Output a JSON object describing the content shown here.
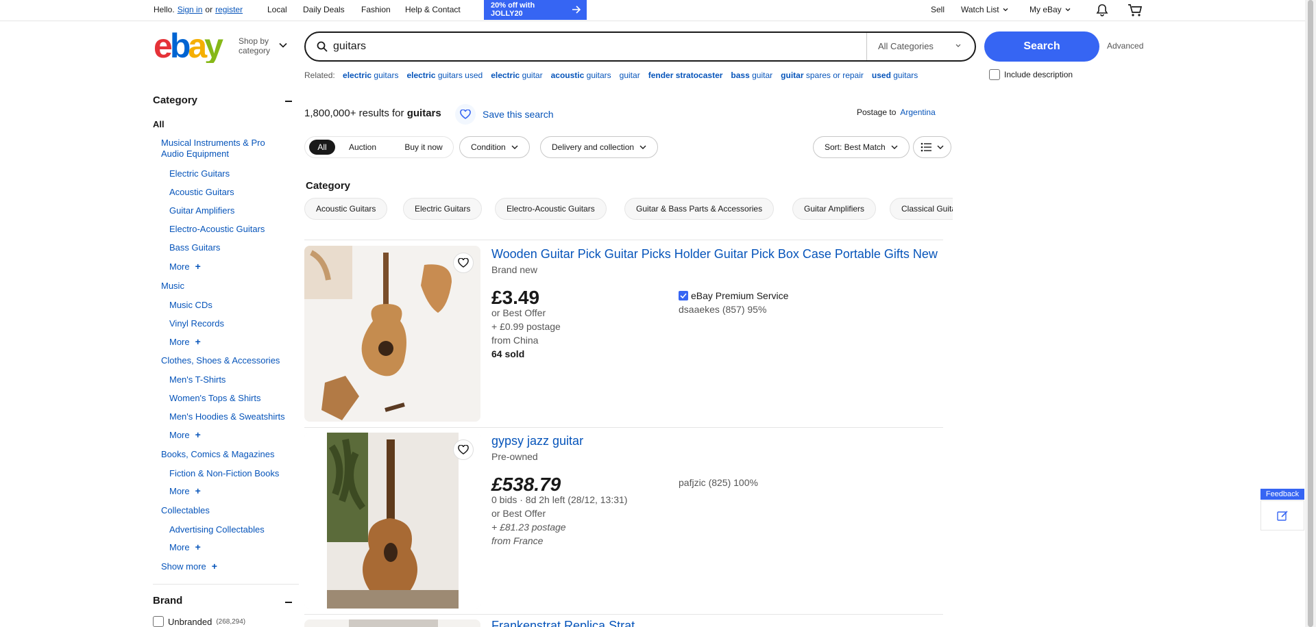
{
  "topbar": {
    "hello": "Hello.",
    "sign_in": "Sign in",
    "or": "or",
    "register": "register",
    "local": "Local",
    "daily_deals": "Daily Deals",
    "fashion": "Fashion",
    "help": "Help & Contact",
    "promo_line1": "20% off with",
    "promo_line2": "JOLLY20",
    "sell": "Sell",
    "watch_list": "Watch List",
    "my_ebay": "My eBay",
    "icons": [
      "bell-icon",
      "cart-icon"
    ]
  },
  "header": {
    "logo_letters": [
      "e",
      "b",
      "a",
      "y"
    ],
    "logo_colors": [
      "#e53238",
      "#0064d2",
      "#f5af02",
      "#86b817"
    ],
    "shop_by_line1": "Shop by",
    "shop_by_line2": "category",
    "search_value": "guitars",
    "category_select": "All Categories",
    "search_button": "Search",
    "advanced": "Advanced"
  },
  "related": {
    "label": "Related:",
    "items": [
      {
        "a": "electric",
        "b": "guitars"
      },
      {
        "a": "electric",
        "b": "guitars used"
      },
      {
        "a": "electric",
        "b": "guitar"
      },
      {
        "a": "acoustic",
        "b": "guitars"
      },
      {
        "a": "",
        "b": "guitar"
      },
      {
        "a": "fender stratocaster",
        "b": ""
      },
      {
        "a": "bass",
        "b": "guitar"
      },
      {
        "a": "guitar",
        "b": "spares or repair"
      },
      {
        "a": "used",
        "b": "guitars"
      }
    ],
    "include_description": "Include description"
  },
  "sidebar": {
    "category_heading": "Category",
    "all": "All",
    "groups": [
      {
        "title": "Musical Instruments & Pro Audio Equipment",
        "items": [
          "Electric Guitars",
          "Acoustic Guitars",
          "Guitar Amplifiers",
          "Electro-Acoustic Guitars",
          "Bass Guitars"
        ],
        "more": "More"
      },
      {
        "title": "Music",
        "items": [
          "Music CDs",
          "Vinyl Records"
        ],
        "more": "More"
      },
      {
        "title": "Clothes, Shoes & Accessories",
        "items": [
          "Men's T-Shirts",
          "Women's Tops & Shirts",
          "Men's Hoodies & Sweatshirts"
        ],
        "more": "More"
      },
      {
        "title": "Books, Comics & Magazines",
        "items": [
          "Fiction & Non-Fiction Books"
        ],
        "more": "More"
      },
      {
        "title": "Collectables",
        "items": [
          "Advertising Collectables"
        ],
        "more": "More"
      }
    ],
    "show_more": "Show more",
    "brand_heading": "Brand",
    "brand_items": [
      {
        "label": "Unbranded",
        "count": "(268,294)"
      }
    ]
  },
  "results": {
    "count": "1,800,000+",
    "results_for": "results for",
    "query": "guitars",
    "save_search": "Save this search",
    "postage_to": "Postage to",
    "country": "Argentina"
  },
  "filters": {
    "tabs": [
      "All",
      "Auction",
      "Buy it now"
    ],
    "active_tab": "All",
    "condition": "Condition",
    "delivery": "Delivery and collection",
    "sort": "Sort: Best Match"
  },
  "categories": {
    "label": "Category",
    "chips": [
      "Acoustic Guitars",
      "Electric Guitars",
      "Electro-Acoustic Guitars",
      "Guitar & Bass Parts & Accessories",
      "Guitar Amplifiers",
      "Classical Guitars"
    ]
  },
  "listings": [
    {
      "title": "Wooden Guitar Pick Guitar Picks Holder Guitar Pick Box Case Portable Gifts New",
      "condition": "Brand new",
      "price": "£3.49",
      "best_offer": "or Best Offer",
      "postage": "+ £0.99 postage",
      "from": "from China",
      "sold": "64 sold",
      "premium": "eBay Premium Service",
      "seller": "dsaaekes (857) 95%"
    },
    {
      "title": "gypsy jazz guitar",
      "condition": "Pre-owned",
      "price": "£538.79",
      "bids": "0 bids · 8d 2h left (28/12, 13:31)",
      "best_offer": "or Best Offer",
      "postage": "+ £81.23 postage",
      "from": "from France",
      "seller": "pafjzic (825) 100%"
    },
    {
      "title": "Frankenstrat Replica Strat"
    }
  ],
  "feedback": {
    "label": "Feedback"
  }
}
